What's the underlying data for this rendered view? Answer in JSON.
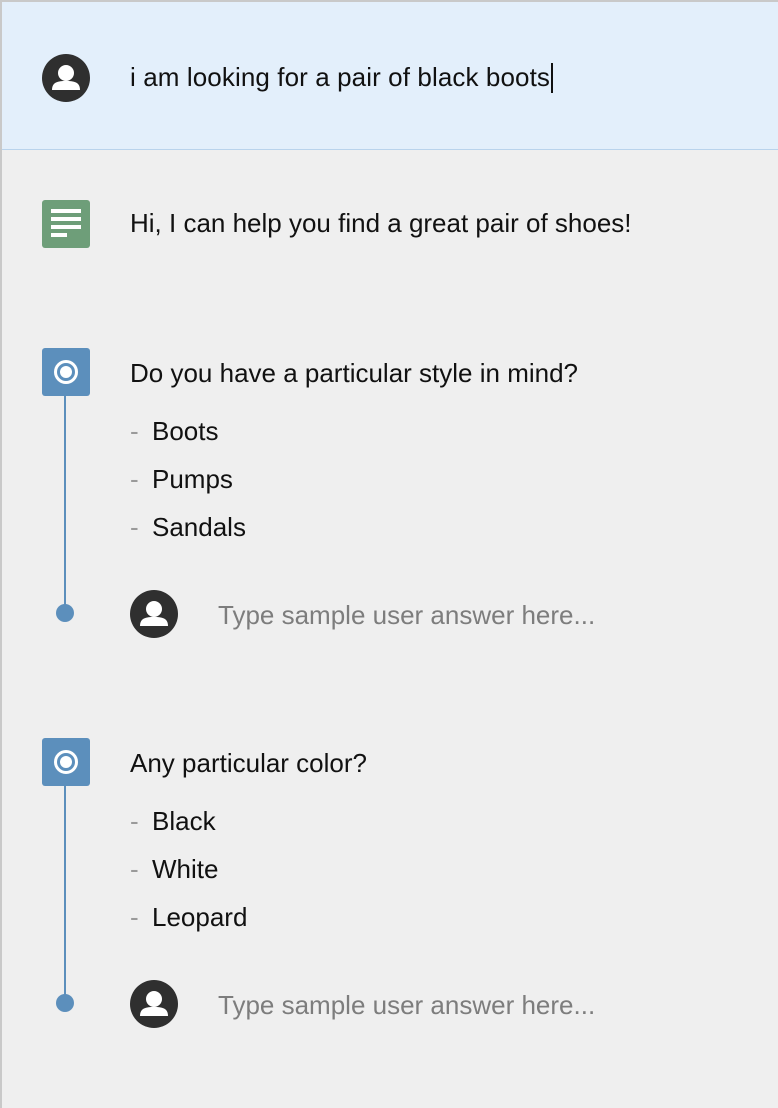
{
  "user_message": {
    "text": "i am looking for a pair of black boots",
    "avatar_icon": "user-avatar-icon"
  },
  "bot_message": {
    "text": "Hi, I can help you find a great pair of shoes!",
    "icon": "document-lines-icon",
    "icon_color": "#6e9e79"
  },
  "questions": [
    {
      "prompt": "Do you have a particular style in mind?",
      "options": [
        "Boots",
        "Pumps",
        "Sandals"
      ],
      "answer_placeholder": "Type sample user answer here..."
    },
    {
      "prompt": "Any particular color?",
      "options": [
        "Black",
        "White",
        "Leopard"
      ],
      "answer_placeholder": "Type sample user answer here..."
    }
  ],
  "colors": {
    "question_accent": "#5c8fbc",
    "user_row_bg": "#e3effb",
    "background": "#efefef"
  }
}
